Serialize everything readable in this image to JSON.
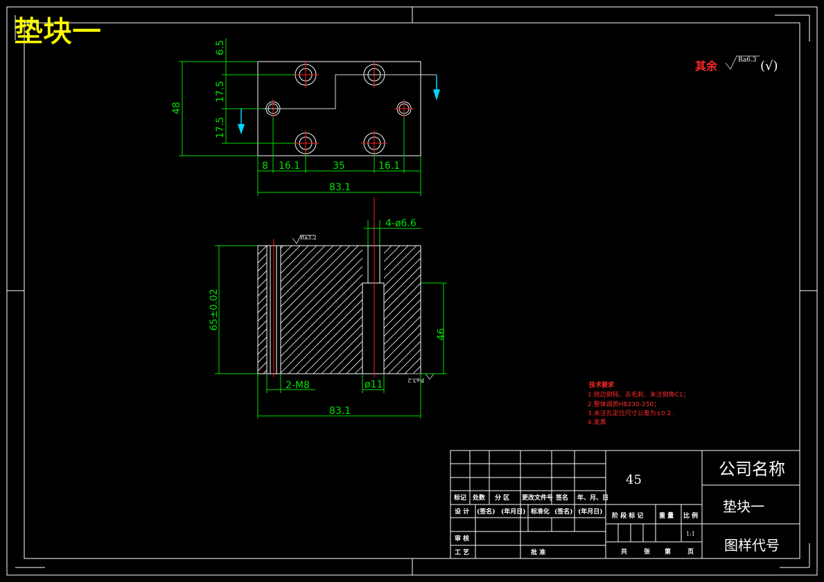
{
  "title": "垫块一",
  "roughness": {
    "rest_label": "其余",
    "rest_value": "Ra6.3",
    "rest_paren": "(√)",
    "top_face": "Ra3.2",
    "bottom_face": "Ra3.2"
  },
  "plan_view_dims": {
    "d1": "6.5",
    "d2": "17.5",
    "d3": "17.5",
    "height": "48",
    "w1": "8",
    "w2": "16.1",
    "w3": "35",
    "w4": "16.1",
    "total_width": "83.1"
  },
  "section_view_dims": {
    "holes": "4-ø6.6",
    "height": "65±0.02",
    "counterbore_depth": "46",
    "thread": "2-M8",
    "counterbore_dia": "ø11",
    "total_width": "83.1"
  },
  "tech_requirements": {
    "heading": "技术要求",
    "items": [
      "1.锐边倒钝，去毛刺，未注倒角C1；",
      "2.整体调质HB230-250；",
      "3.未注孔定位尺寸公差为±0.2 .",
      "4.发黑"
    ]
  },
  "title_block": {
    "material": "45",
    "company": "公司名称",
    "part_name": "垫块一",
    "drawing_no": "图样代号",
    "scale": "1:1",
    "row_mark": [
      "标记",
      "处数",
      "分 区",
      "更改文件号",
      "签名",
      "年、月、日"
    ],
    "row_design": [
      "设 计",
      "(签名)",
      "(年月日)",
      "标准化",
      "(签名)",
      "(年月日)"
    ],
    "row_review": "审 核",
    "row_process": "工 艺",
    "approve": "批 准",
    "stage_labels": [
      "阶 段 标 记",
      "重 量",
      "比 例"
    ],
    "sheet_labels": [
      "共",
      "张",
      "第",
      "页"
    ]
  }
}
